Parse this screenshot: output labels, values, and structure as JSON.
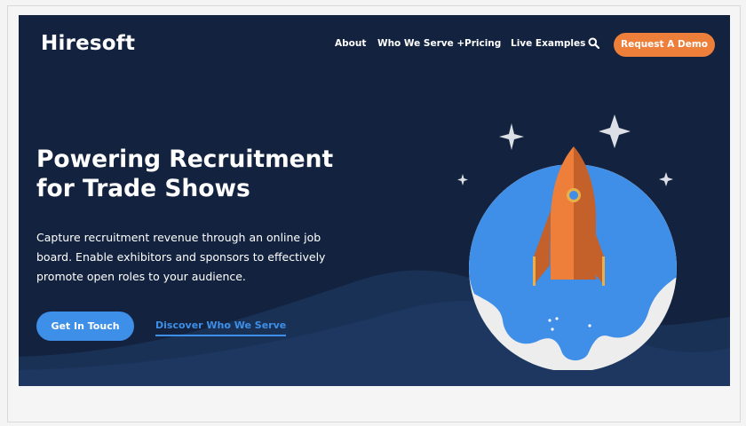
{
  "brand": {
    "logo_text": "Hiresoft"
  },
  "nav": {
    "items": [
      {
        "label": "About"
      },
      {
        "label": "Who We Serve +"
      },
      {
        "label": "Pricing"
      },
      {
        "label": "Live Examples"
      }
    ],
    "search_icon": "search-icon",
    "cta_label": "Request A Demo"
  },
  "hero": {
    "headline": "Powering Recruitment for Trade Shows",
    "subtext": "Capture recruitment revenue through an online job board. Enable exhibitors and sponsors to effectively promote open roles to your audience.",
    "primary_button": "Get In Touch",
    "secondary_link": "Discover Who We Serve",
    "illustration": "rocket-launch-illustration"
  },
  "colors": {
    "hero_bg": "#13233f",
    "accent_orange": "#ee7f3a",
    "accent_blue": "#3d8fe8",
    "page_bg": "#f5f5f5"
  }
}
